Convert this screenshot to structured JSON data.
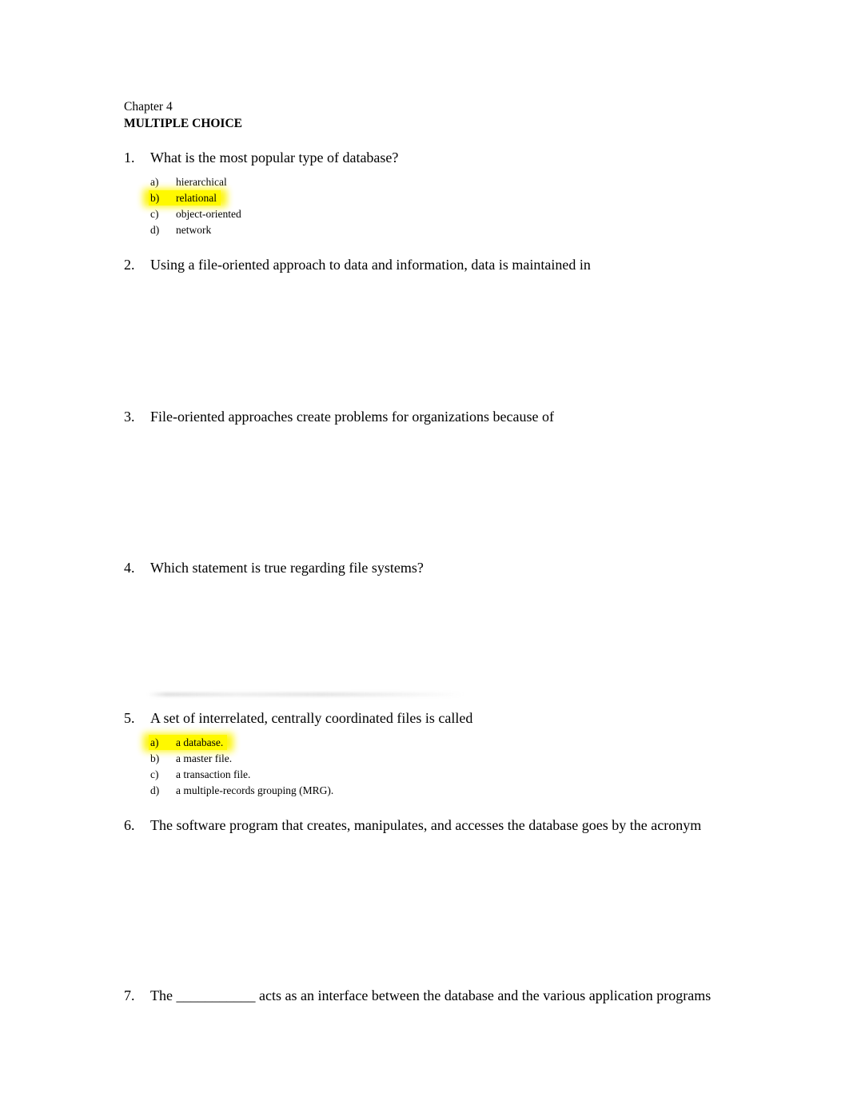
{
  "document": {
    "chapter_label": "Chapter 4",
    "section_label": "MULTIPLE CHOICE"
  },
  "highlight_color": "#fff900",
  "questions": [
    {
      "number": "1.",
      "text": "What is the most popular type of database?",
      "options": [
        {
          "letter": "a)",
          "text": "hierarchical",
          "highlighted": false
        },
        {
          "letter": "b)",
          "text": "relational",
          "highlighted": true
        },
        {
          "letter": "c)",
          "text": "object-oriented",
          "highlighted": false
        },
        {
          "letter": "d)",
          "text": "network",
          "highlighted": false
        }
      ]
    },
    {
      "number": "2.",
      "text": "Using a file-oriented approach to data and information, data is maintained in",
      "options": []
    },
    {
      "number": "3.",
      "text": "File-oriented approaches create problems for organizations because of",
      "options": []
    },
    {
      "number": "4.",
      "text": "Which statement is true regarding file systems?",
      "options": []
    },
    {
      "number": "5.",
      "text": "A set of interrelated, centrally coordinated files is called",
      "options": [
        {
          "letter": "a)",
          "text": "a database.",
          "highlighted": true
        },
        {
          "letter": "b)",
          "text": "a master file.",
          "highlighted": false
        },
        {
          "letter": "c)",
          "text": "a transaction file.",
          "highlighted": false
        },
        {
          "letter": "d)",
          "text": "a multiple-records grouping (MRG).",
          "highlighted": false
        }
      ]
    },
    {
      "number": "6.",
      "text": "The software program that creates, manipulates, and accesses the database goes by the acronym",
      "options": []
    },
    {
      "number": "7.",
      "text": "The ___________ acts as an interface between the database and the various application programs",
      "options": []
    }
  ]
}
